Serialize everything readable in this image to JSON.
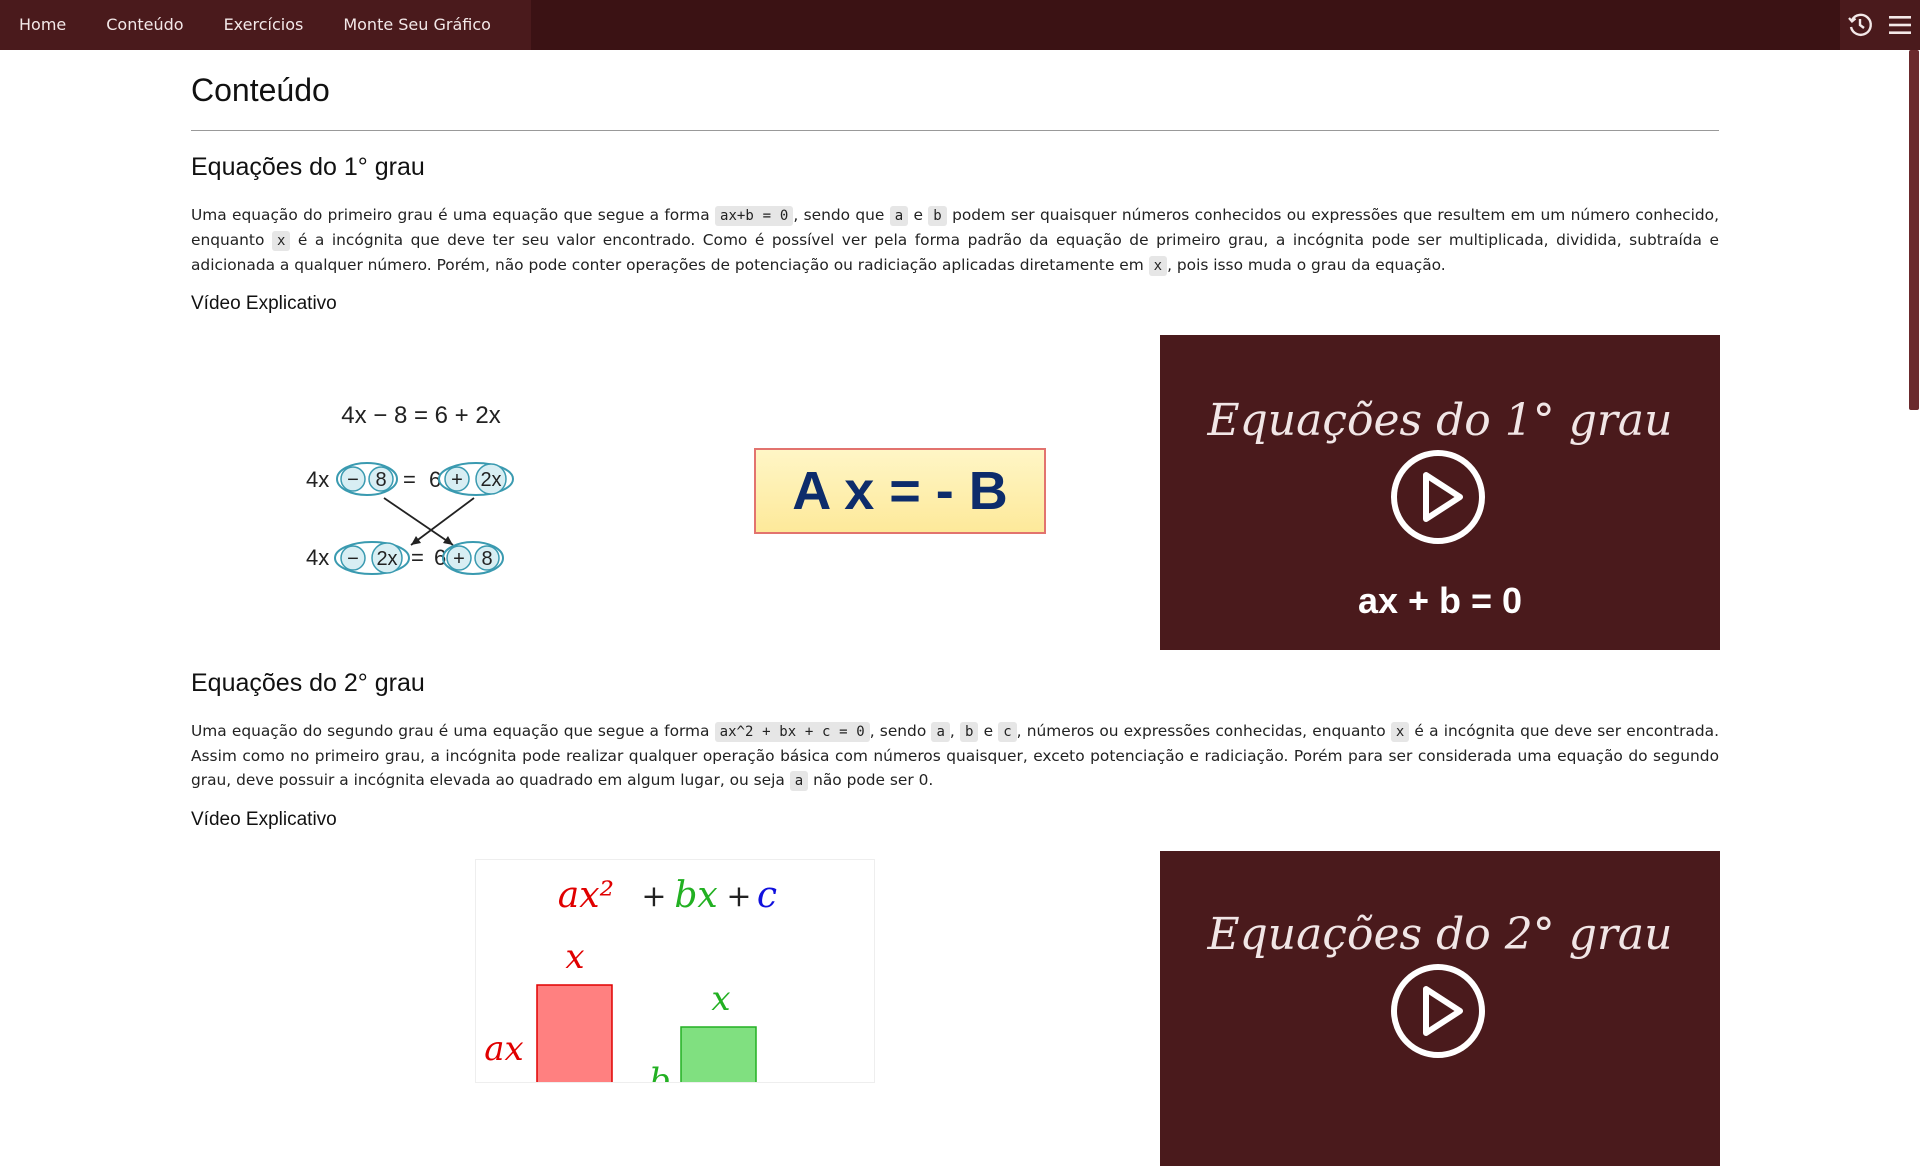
{
  "nav": {
    "links": [
      "Home",
      "Conteúdo",
      "Exercícios",
      "Monte Seu Gráfico"
    ],
    "icons": [
      "history-icon",
      "menu-icon"
    ]
  },
  "page": {
    "title": "Conteúdo"
  },
  "section1": {
    "title": "Equações do 1° grau",
    "p_parts": [
      "Uma equação do primeiro grau é uma equação que segue a forma ",
      "ax+b = 0",
      ", sendo que ",
      "a",
      " e ",
      "b",
      " podem ser quaisquer números conhecidos ou expressões que resultem em um número conhecido, enquanto ",
      "x",
      " é a incógnita que deve ter seu valor encontrado. Como é possível ver pela forma padrão da equação de primeiro grau, a incógnita pode ser multiplicada, dividida, subtraída e adicionada a qualquer número. Porém, não pode conter operações de potenciação ou radiciação aplicadas diretamente em ",
      "x",
      ", pois isso muda o grau da equação."
    ],
    "video_heading": "Vídeo Explicativo",
    "illustration": {
      "top": "4x − 8 = 6 + 2x",
      "row1_left": "4x",
      "row1_terms": [
        "−",
        "8",
        "=",
        "6",
        "+",
        "2x"
      ],
      "row2_left": "4x",
      "row2_terms": [
        "−",
        "2x",
        "=",
        "6",
        "+",
        "8"
      ]
    },
    "formula_box": "A x = - B",
    "video": {
      "title": "Equações do 1° grau",
      "formula": "ax + b = 0"
    }
  },
  "section2": {
    "title": "Equações do 2° grau",
    "p_parts": [
      "Uma equação do segundo grau é uma equação que segue a forma ",
      "ax^2 + bx + c = 0",
      ", sendo ",
      "a",
      ", ",
      "b",
      " e ",
      "c",
      ", números ou expressões conhecidas, enquanto ",
      "x",
      " é a incógnita que deve ser encontrada. Assim como no primeiro grau, a incógnita pode realizar qualquer operação básica com números quaisquer, exceto potenciação e radiciação. Porém para ser considerada uma equação do segundo grau, deve possuir a incógnita elevada ao quadrado em algum lugar, ou seja ",
      "a",
      " não pode ser 0."
    ],
    "video_heading": "Vídeo Explicativo",
    "diagram": {
      "formula_a": "ax²",
      "formula_plus1": "+",
      "formula_b": "bx",
      "formula_plus2": "+",
      "formula_c": "c",
      "label_x1": "x",
      "label_ax": "ax",
      "label_x2": "x",
      "label_b": "b"
    },
    "video": {
      "title": "Equações do 2° grau"
    }
  },
  "colors": {
    "navbar": "#3b1214",
    "video_bg": "#4a1a1c",
    "red": "#e00000",
    "green": "#22b022",
    "blue": "#1010dd"
  }
}
